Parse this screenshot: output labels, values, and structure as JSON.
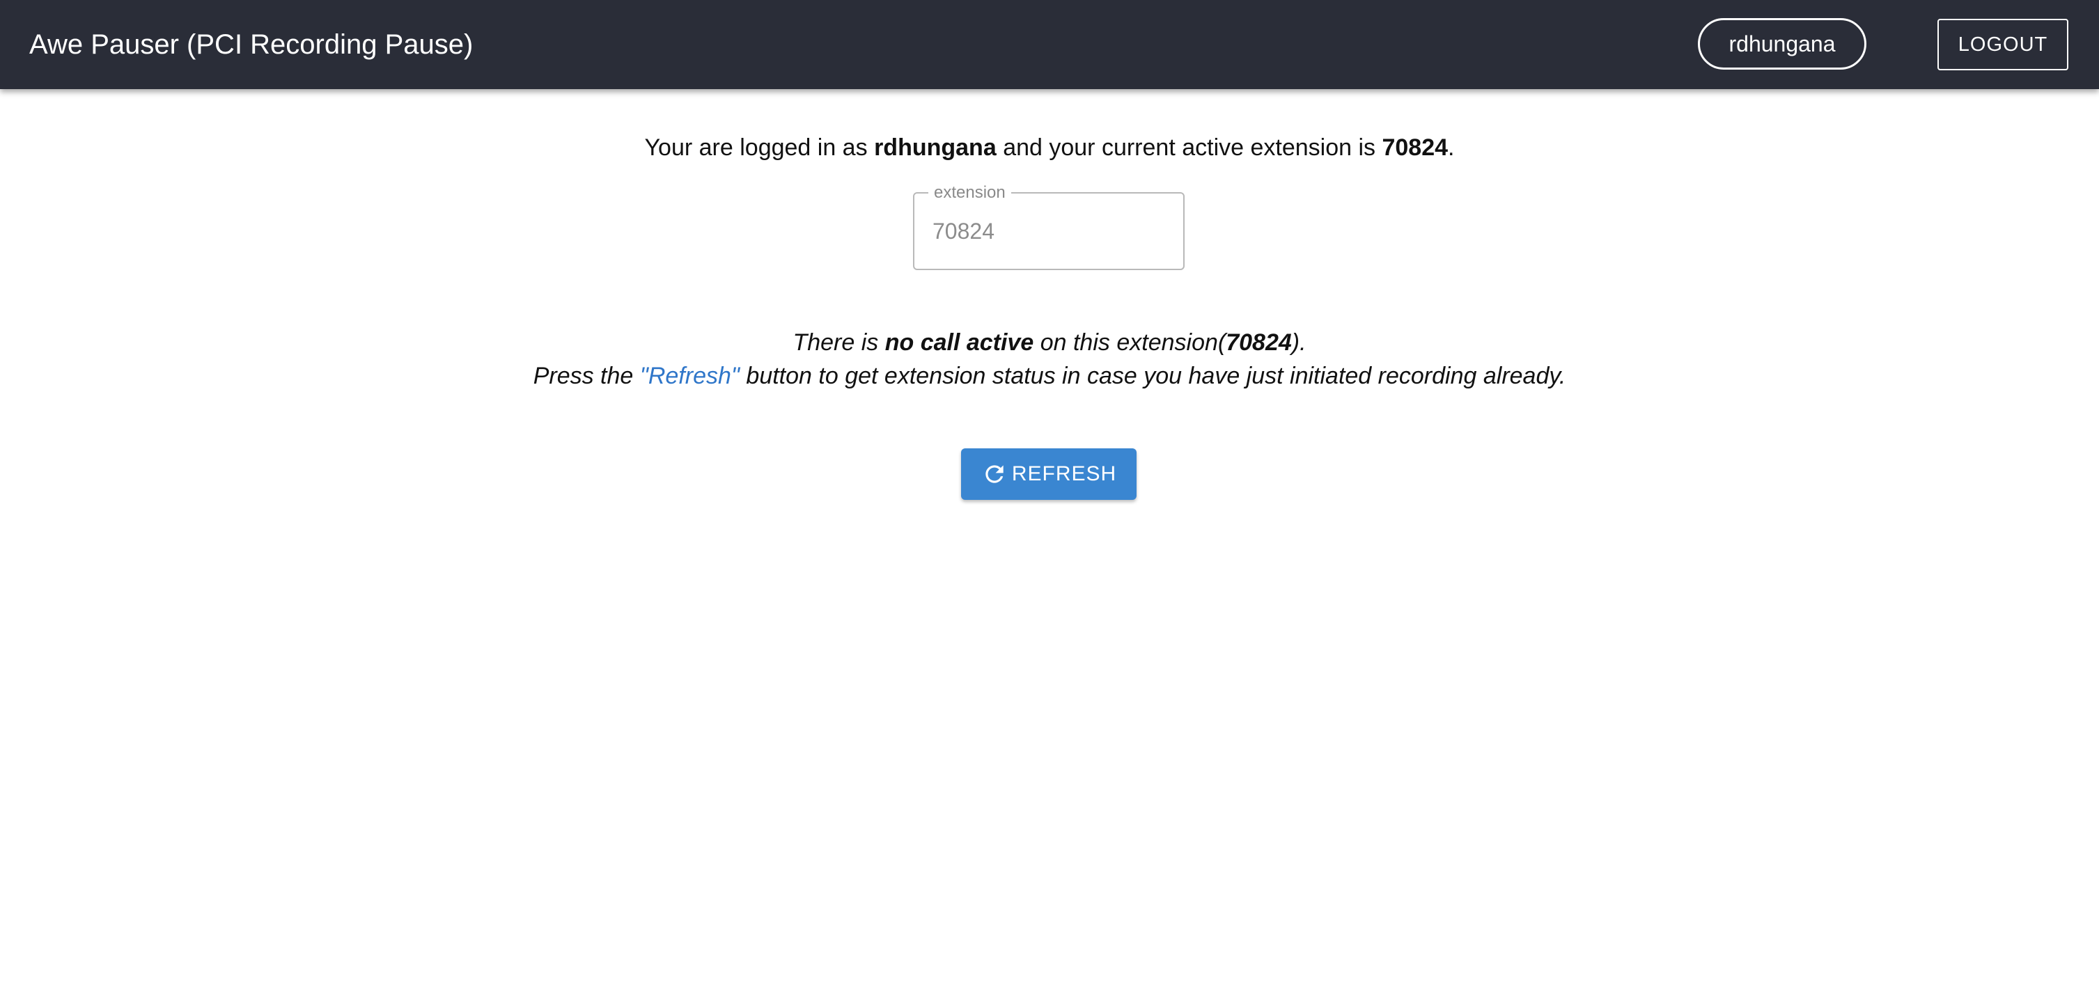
{
  "header": {
    "title": "Awe Pauser (PCI Recording Pause)",
    "user_chip_label": "rdhungana",
    "logout_label": "LOGOUT"
  },
  "status": {
    "prefix": "Your are logged in as",
    "username": "rdhungana",
    "middle": "and your current active extension is",
    "extension": "70824",
    "suffix": "."
  },
  "extension_field": {
    "label": "extension",
    "value": "70824"
  },
  "message": {
    "line1_prefix": "There is",
    "line1_bold": "no call active",
    "line1_middle": "on this extension(",
    "line1_extension": "70824",
    "line1_suffix": ").",
    "line2_prefix": "Press the",
    "line2_link": "\"Refresh\"",
    "line2_suffix": "button to get extension status in case you have just initiated recording already."
  },
  "refresh_button": {
    "label": "REFRESH",
    "icon": "refresh-icon"
  },
  "colors": {
    "appbar": "#2a2d38",
    "accent": "#3a86d1",
    "link": "#2f76c9"
  }
}
